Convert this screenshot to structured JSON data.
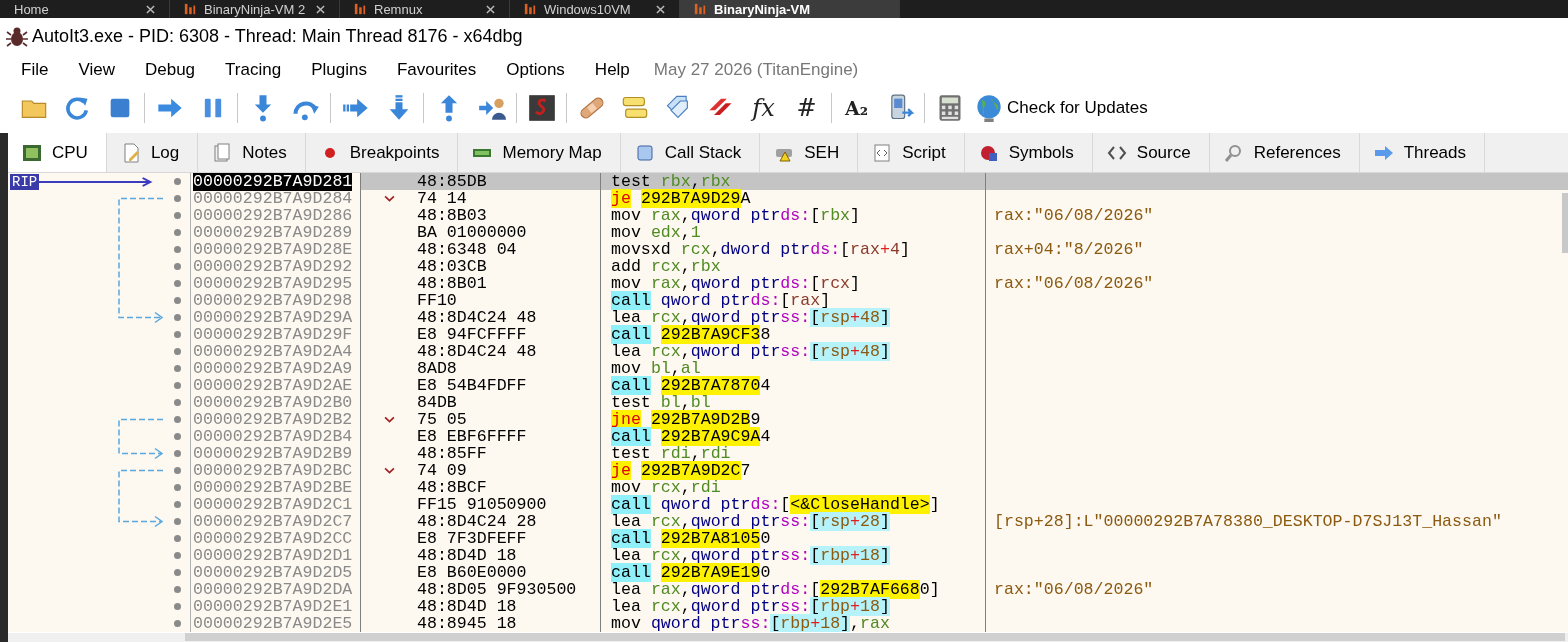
{
  "browser_tabs": [
    {
      "label": "Home",
      "selected": false
    },
    {
      "label": "BinaryNinja-VM 2",
      "selected": false
    },
    {
      "label": "Remnux",
      "selected": false
    },
    {
      "label": "Windows10VM",
      "selected": false
    },
    {
      "label": "BinaryNinja-VM",
      "selected": true
    }
  ],
  "window": {
    "title": "AutoIt3.exe - PID: 6308 - Thread: Main Thread 8176 - x64dbg"
  },
  "menu": [
    "File",
    "View",
    "Debug",
    "Tracing",
    "Plugins",
    "Favourites",
    "Options",
    "Help"
  ],
  "build_info": "May 27 2026 (TitanEngine)",
  "toolbar": {
    "glyphs": [
      "fx",
      "#",
      "A₂"
    ],
    "update_button": "Check for Updates"
  },
  "tabs": [
    {
      "label": "CPU",
      "selected": true
    },
    {
      "label": "Log",
      "selected": false
    },
    {
      "label": "Notes",
      "selected": false
    },
    {
      "label": "Breakpoints",
      "selected": false
    },
    {
      "label": "Memory Map",
      "selected": false
    },
    {
      "label": "Call Stack",
      "selected": false
    },
    {
      "label": "SEH",
      "selected": false
    },
    {
      "label": "Script",
      "selected": false
    },
    {
      "label": "Symbols",
      "selected": false
    },
    {
      "label": "Source",
      "selected": false
    },
    {
      "label": "References",
      "selected": false
    },
    {
      "label": "Threads",
      "selected": false
    }
  ],
  "rows": [
    {
      "rip_label": "RIP",
      "address": "00000292B7A9D281",
      "bytes": "48:85DB",
      "jump": false,
      "jump_source": false,
      "jump_target": false,
      "selected": true,
      "ins": [
        {
          "text": "test",
          "kind": "mn"
        },
        {
          "text": "rbx",
          "kind": "reg"
        },
        {
          "text": ",",
          "kind": "punct"
        },
        {
          "text": "rbx",
          "kind": "reg"
        }
      ]
    },
    {
      "address": "00000292B7A9D284",
      "bytes": "74 14",
      "jump": true,
      "jump_source": true,
      "jump_target": false,
      "selected": false,
      "ins": [
        {
          "text": "je",
          "kind": "jmp"
        },
        {
          "text": "292B7A9D29",
          "kind": "addr"
        },
        {
          "text": "A",
          "kind": "punct"
        }
      ]
    },
    {
      "address": "00000292B7A9D286",
      "bytes": "48:8B03",
      "jump": false,
      "jump_source": false,
      "jump_target": false,
      "selected": false,
      "ins": [
        {
          "text": "mov",
          "kind": "mn"
        },
        {
          "text": "rax",
          "kind": "reg"
        },
        {
          "text": ",",
          "kind": "punct"
        },
        {
          "text": "qword ptr",
          "kind": "size"
        },
        {
          "text": "ds:",
          "kind": "seg"
        },
        {
          "text": "[",
          "kind": "punct"
        },
        {
          "text": "rbx",
          "kind": "reg"
        },
        {
          "text": "]",
          "kind": "punct"
        }
      ],
      "comment": "rax:\"06/08/2026\""
    },
    {
      "address": "00000292B7A9D289",
      "bytes": "BA 01000000",
      "jump": false,
      "jump_source": false,
      "jump_target": false,
      "selected": false,
      "ins": [
        {
          "text": "mov",
          "kind": "mn"
        },
        {
          "text": "edx",
          "kind": "reg"
        },
        {
          "text": ",",
          "kind": "punct"
        },
        {
          "text": "1",
          "kind": "reg"
        }
      ]
    },
    {
      "address": "00000292B7A9D28E",
      "bytes": "48:6348 04",
      "jump": false,
      "jump_source": false,
      "jump_target": false,
      "selected": false,
      "ins": [
        {
          "text": "movsxd",
          "kind": "mn"
        },
        {
          "text": "rcx",
          "kind": "reg"
        },
        {
          "text": ",",
          "kind": "punct"
        },
        {
          "text": "dword ptr",
          "kind": "size"
        },
        {
          "text": "ds:",
          "kind": "seg"
        },
        {
          "text": "[",
          "kind": "punct"
        },
        {
          "text": "rax",
          "kind": "num"
        },
        {
          "text": "+",
          "kind": "op"
        },
        {
          "text": "4",
          "kind": "num"
        },
        {
          "text": "]",
          "kind": "punct"
        }
      ],
      "comment": "rax+04:\"8/2026\""
    },
    {
      "address": "00000292B7A9D292",
      "bytes": "48:03CB",
      "jump": false,
      "jump_source": false,
      "jump_target": false,
      "selected": false,
      "ins": [
        {
          "text": "add",
          "kind": "mn"
        },
        {
          "text": "rcx",
          "kind": "reg"
        },
        {
          "text": ",",
          "kind": "punct"
        },
        {
          "text": "rbx",
          "kind": "reg"
        }
      ]
    },
    {
      "address": "00000292B7A9D295",
      "bytes": "48:8B01",
      "jump": false,
      "jump_source": false,
      "jump_target": false,
      "selected": false,
      "ins": [
        {
          "text": "mov",
          "kind": "mn"
        },
        {
          "text": "rax",
          "kind": "reg"
        },
        {
          "text": ",",
          "kind": "punct"
        },
        {
          "text": "qword ptr",
          "kind": "size"
        },
        {
          "text": "ds:",
          "kind": "seg"
        },
        {
          "text": "[",
          "kind": "punct"
        },
        {
          "text": "rcx",
          "kind": "num"
        },
        {
          "text": "]",
          "kind": "punct"
        }
      ],
      "comment": "rax:\"06/08/2026\""
    },
    {
      "address": "00000292B7A9D298",
      "bytes": "FF10",
      "jump": false,
      "jump_source": false,
      "jump_target": false,
      "selected": false,
      "ins": [
        {
          "text": "call",
          "kind": "call"
        },
        {
          "text": "qword ptr",
          "kind": "size"
        },
        {
          "text": "ds:",
          "kind": "seg"
        },
        {
          "text": "[",
          "kind": "punct"
        },
        {
          "text": "rax",
          "kind": "num"
        },
        {
          "text": "]",
          "kind": "punct"
        }
      ]
    },
    {
      "address": "00000292B7A9D29A",
      "bytes": "48:8D4C24 48",
      "jump": false,
      "jump_source": false,
      "jump_target": true,
      "selected": false,
      "ins": [
        {
          "text": "lea",
          "kind": "mn"
        },
        {
          "text": "rcx",
          "kind": "reg"
        },
        {
          "text": ",",
          "kind": "punct"
        },
        {
          "text": "qword ptr",
          "kind": "size"
        },
        {
          "text": "ss:",
          "kind": "seg"
        },
        {
          "text": "[",
          "kind": "spunct"
        },
        {
          "text": "rsp",
          "kind": "snum"
        },
        {
          "text": "+",
          "kind": "sop"
        },
        {
          "text": "48",
          "kind": "snum"
        },
        {
          "text": "]",
          "kind": "spunct"
        }
      ]
    },
    {
      "address": "00000292B7A9D29F",
      "bytes": "E8 94FCFFFF",
      "jump": false,
      "jump_source": false,
      "jump_target": false,
      "selected": false,
      "ins": [
        {
          "text": "call",
          "kind": "call"
        },
        {
          "text": "292B7A9CF3",
          "kind": "addr"
        },
        {
          "text": "8",
          "kind": "punct"
        }
      ]
    },
    {
      "address": "00000292B7A9D2A4",
      "bytes": "48:8D4C24 48",
      "jump": false,
      "jump_source": false,
      "jump_target": false,
      "selected": false,
      "ins": [
        {
          "text": "lea",
          "kind": "mn"
        },
        {
          "text": "rcx",
          "kind": "reg"
        },
        {
          "text": ",",
          "kind": "punct"
        },
        {
          "text": "qword ptr",
          "kind": "size"
        },
        {
          "text": "ss:",
          "kind": "seg"
        },
        {
          "text": "[",
          "kind": "spunct"
        },
        {
          "text": "rsp",
          "kind": "snum"
        },
        {
          "text": "+",
          "kind": "sop"
        },
        {
          "text": "48",
          "kind": "snum"
        },
        {
          "text": "]",
          "kind": "spunct"
        }
      ]
    },
    {
      "address": "00000292B7A9D2A9",
      "bytes": "8AD8",
      "jump": false,
      "jump_source": false,
      "jump_target": false,
      "selected": false,
      "ins": [
        {
          "text": "mov",
          "kind": "mn"
        },
        {
          "text": "bl",
          "kind": "reg"
        },
        {
          "text": ",",
          "kind": "punct"
        },
        {
          "text": "al",
          "kind": "reg"
        }
      ]
    },
    {
      "address": "00000292B7A9D2AE",
      "bytes": "E8 54B4FDFF",
      "jump": false,
      "jump_source": false,
      "jump_target": false,
      "selected": false,
      "ins": [
        {
          "text": "call",
          "kind": "call"
        },
        {
          "text": "292B7A7870",
          "kind": "addr"
        },
        {
          "text": "4",
          "kind": "punct"
        }
      ]
    },
    {
      "address": "00000292B7A9D2B0",
      "bytes": "84DB",
      "jump": false,
      "jump_source": false,
      "jump_target": false,
      "selected": false,
      "ins": [
        {
          "text": "test",
          "kind": "mn"
        },
        {
          "text": "bl",
          "kind": "reg"
        },
        {
          "text": ",",
          "kind": "punct"
        },
        {
          "text": "bl",
          "kind": "reg"
        }
      ]
    },
    {
      "address": "00000292B7A9D2B2",
      "bytes": "75 05",
      "jump": true,
      "jump_source": true,
      "jump_target": false,
      "selected": false,
      "ins": [
        {
          "text": "jne",
          "kind": "jmp"
        },
        {
          "text": "292B7A9D2B",
          "kind": "addr"
        },
        {
          "text": "9",
          "kind": "punct"
        }
      ]
    },
    {
      "address": "00000292B7A9D2B4",
      "bytes": "E8 EBF6FFFF",
      "jump": false,
      "jump_source": false,
      "jump_target": false,
      "selected": false,
      "ins": [
        {
          "text": "call",
          "kind": "call"
        },
        {
          "text": "292B7A9C9A",
          "kind": "addr"
        },
        {
          "text": "4",
          "kind": "punct"
        }
      ]
    },
    {
      "address": "00000292B7A9D2B9",
      "bytes": "48:85FF",
      "jump": false,
      "jump_source": false,
      "jump_target": true,
      "selected": false,
      "ins": [
        {
          "text": "test",
          "kind": "mn"
        },
        {
          "text": "rdi",
          "kind": "reg"
        },
        {
          "text": ",",
          "kind": "punct"
        },
        {
          "text": "rdi",
          "kind": "reg"
        }
      ]
    },
    {
      "address": "00000292B7A9D2BC",
      "bytes": "74 09",
      "jump": true,
      "jump_source": true,
      "jump_target": false,
      "selected": false,
      "ins": [
        {
          "text": "je",
          "kind": "jmp"
        },
        {
          "text": "292B7A9D2C",
          "kind": "addr"
        },
        {
          "text": "7",
          "kind": "punct"
        }
      ]
    },
    {
      "address": "00000292B7A9D2BE",
      "bytes": "48:8BCF",
      "jump": false,
      "jump_source": false,
      "jump_target": false,
      "selected": false,
      "ins": [
        {
          "text": "mov",
          "kind": "mn"
        },
        {
          "text": "rcx",
          "kind": "reg"
        },
        {
          "text": ",",
          "kind": "punct"
        },
        {
          "text": "rdi",
          "kind": "reg"
        }
      ]
    },
    {
      "address": "00000292B7A9D2C1",
      "bytes": "FF15 91050900",
      "jump": false,
      "jump_source": false,
      "jump_target": false,
      "selected": false,
      "ins": [
        {
          "text": "call",
          "kind": "call"
        },
        {
          "text": "qword ptr",
          "kind": "size"
        },
        {
          "text": "ds:",
          "kind": "seg"
        },
        {
          "text": "[",
          "kind": "punct"
        },
        {
          "text": "<&CloseHandle>",
          "kind": "addr"
        },
        {
          "text": "]",
          "kind": "punct"
        }
      ]
    },
    {
      "address": "00000292B7A9D2C7",
      "bytes": "48:8D4C24 28",
      "jump": false,
      "jump_source": false,
      "jump_target": true,
      "selected": false,
      "ins": [
        {
          "text": "lea",
          "kind": "mn"
        },
        {
          "text": "rcx",
          "kind": "reg"
        },
        {
          "text": ",",
          "kind": "punct"
        },
        {
          "text": "qword ptr",
          "kind": "size"
        },
        {
          "text": "ss:",
          "kind": "seg"
        },
        {
          "text": "[",
          "kind": "spunct"
        },
        {
          "text": "rsp",
          "kind": "snum"
        },
        {
          "text": "+",
          "kind": "sop"
        },
        {
          "text": "28",
          "kind": "snum"
        },
        {
          "text": "]",
          "kind": "spunct"
        }
      ],
      "comment": "[rsp+28]:L\"00000292B7A78380_DESKTOP-D7SJ13T_Hassan\""
    },
    {
      "address": "00000292B7A9D2CC",
      "bytes": "E8 7F3DFEFF",
      "jump": false,
      "jump_source": false,
      "jump_target": false,
      "selected": false,
      "ins": [
        {
          "text": "call",
          "kind": "call"
        },
        {
          "text": "292B7A8105",
          "kind": "addr"
        },
        {
          "text": "0",
          "kind": "punct"
        }
      ]
    },
    {
      "address": "00000292B7A9D2D1",
      "bytes": "48:8D4D 18",
      "jump": false,
      "jump_source": false,
      "jump_target": false,
      "selected": false,
      "ins": [
        {
          "text": "lea",
          "kind": "mn"
        },
        {
          "text": "rcx",
          "kind": "reg"
        },
        {
          "text": ",",
          "kind": "punct"
        },
        {
          "text": "qword ptr",
          "kind": "size"
        },
        {
          "text": "ss:",
          "kind": "seg"
        },
        {
          "text": "[",
          "kind": "spunct"
        },
        {
          "text": "rbp",
          "kind": "snum"
        },
        {
          "text": "+",
          "kind": "sop"
        },
        {
          "text": "18",
          "kind": "snum"
        },
        {
          "text": "]",
          "kind": "spunct"
        }
      ]
    },
    {
      "address": "00000292B7A9D2D5",
      "bytes": "E8 B60E0000",
      "jump": false,
      "jump_source": false,
      "jump_target": false,
      "selected": false,
      "ins": [
        {
          "text": "call",
          "kind": "call"
        },
        {
          "text": "292B7A9E19",
          "kind": "addr"
        },
        {
          "text": "0",
          "kind": "punct"
        }
      ]
    },
    {
      "address": "00000292B7A9D2DA",
      "bytes": "48:8D05 9F930500",
      "jump": false,
      "jump_source": false,
      "jump_target": false,
      "selected": false,
      "ins": [
        {
          "text": "lea",
          "kind": "mn"
        },
        {
          "text": "rax",
          "kind": "reg"
        },
        {
          "text": ",",
          "kind": "punct"
        },
        {
          "text": "qword ptr",
          "kind": "size"
        },
        {
          "text": "ds:",
          "kind": "seg"
        },
        {
          "text": "[",
          "kind": "punct"
        },
        {
          "text": "292B7AF668",
          "kind": "addr"
        },
        {
          "text": "0",
          "kind": "punct"
        },
        {
          "text": "]",
          "kind": "punct"
        }
      ],
      "comment": "rax:\"06/08/2026\""
    },
    {
      "address": "00000292B7A9D2E1",
      "bytes": "48:8D4D 18",
      "jump": false,
      "jump_source": false,
      "jump_target": false,
      "selected": false,
      "ins": [
        {
          "text": "lea",
          "kind": "mn"
        },
        {
          "text": "rcx",
          "kind": "reg"
        },
        {
          "text": ",",
          "kind": "punct"
        },
        {
          "text": "qword ptr",
          "kind": "size"
        },
        {
          "text": "ss:",
          "kind": "seg"
        },
        {
          "text": "[",
          "kind": "spunct"
        },
        {
          "text": "rbp",
          "kind": "snum"
        },
        {
          "text": "+",
          "kind": "sop"
        },
        {
          "text": "18",
          "kind": "snum"
        },
        {
          "text": "]",
          "kind": "spunct"
        }
      ]
    },
    {
      "address": "00000292B7A9D2E5",
      "bytes": "48:8945 18",
      "jump": false,
      "jump_source": false,
      "jump_target": false,
      "selected": false,
      "ins": [
        {
          "text": "mov",
          "kind": "mn"
        },
        {
          "text": "qword ptr",
          "kind": "size"
        },
        {
          "text": "ss:",
          "kind": "seg"
        },
        {
          "text": "[",
          "kind": "spunct"
        },
        {
          "text": "rbp",
          "kind": "snum"
        },
        {
          "text": "+",
          "kind": "sop"
        },
        {
          "text": "18",
          "kind": "snum"
        },
        {
          "text": "]",
          "kind": "spunct"
        },
        {
          "text": ",",
          "kind": "punct"
        },
        {
          "text": "rax",
          "kind": "reg"
        }
      ]
    }
  ]
}
